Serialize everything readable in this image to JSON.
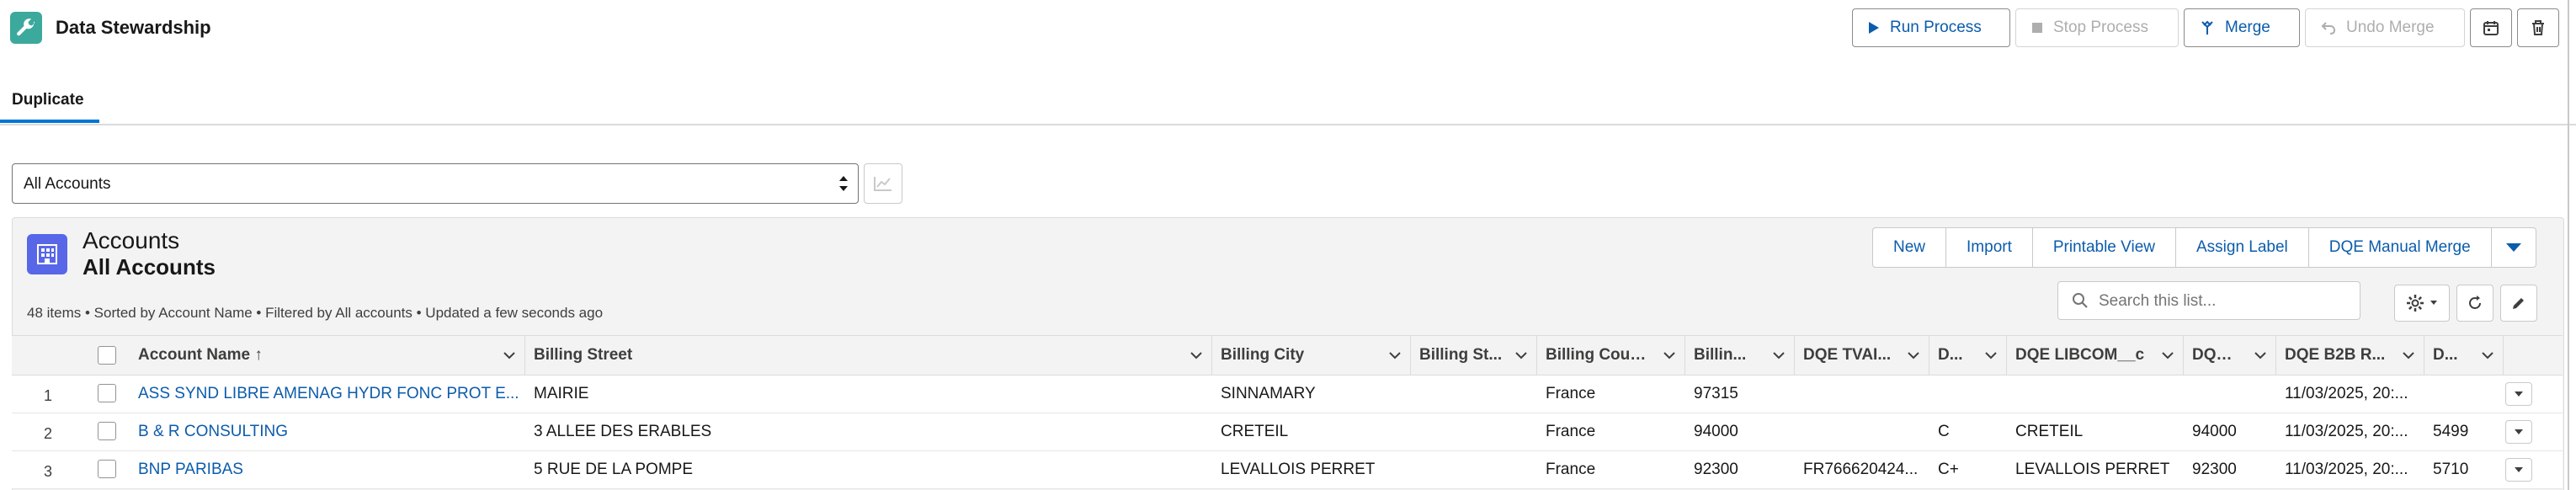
{
  "app": {
    "title": "Data Stewardship",
    "icon": "wrench-icon",
    "accent": "#3ba99c"
  },
  "toolbar": {
    "run_process": "Run Process",
    "stop_process": "Stop Process",
    "merge": "Merge",
    "undo_merge": "Undo Merge"
  },
  "tabs": [
    {
      "label": "Duplicate",
      "active": true
    }
  ],
  "list_selector": {
    "value": "All Accounts"
  },
  "list_view": {
    "object_name": "Accounts",
    "view_name": "All Accounts",
    "meta": "48 items • Sorted by Account Name • Filtered by All accounts • Updated a few seconds ago",
    "buttons": [
      "New",
      "Import",
      "Printable View",
      "Assign Label",
      "DQE Manual Merge"
    ],
    "search_placeholder": "Search this list...",
    "object_color": "#5867e8"
  },
  "table": {
    "columns": [
      "Account Name",
      "Billing Street",
      "Billing City",
      "Billing St...",
      "Billing Coun...",
      "Billin...",
      "DQE TVAI...",
      "D...",
      "DQE LIBCOM__c",
      "DQE ...",
      "DQE B2B R...",
      "D..."
    ],
    "sorted_column_indicator": "↑",
    "rows": [
      {
        "num": "1",
        "cells": [
          "ASS SYND LIBRE AMENAG HYDR FONC PROT E...",
          "MAIRIE",
          "SINNAMARY",
          "",
          "France",
          "97315",
          "",
          "",
          "",
          "",
          "11/03/2025, 20:...",
          ""
        ]
      },
      {
        "num": "2",
        "cells": [
          "B & R CONSULTING",
          "3 ALLEE DES ERABLES",
          "CRETEIL",
          "",
          "France",
          "94000",
          "",
          "C",
          "CRETEIL",
          "94000",
          "11/03/2025, 20:...",
          "5499"
        ]
      },
      {
        "num": "3",
        "cells": [
          "BNP PARIBAS",
          "5 RUE DE LA POMPE",
          "LEVALLOIS PERRET",
          "",
          "France",
          "92300",
          "FR766620424...",
          "C+",
          "LEVALLOIS PERRET",
          "92300",
          "11/03/2025, 20:...",
          "5710"
        ]
      }
    ]
  }
}
